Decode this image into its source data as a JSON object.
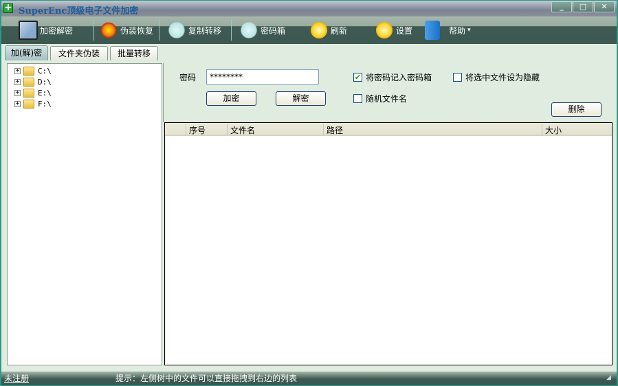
{
  "window": {
    "title": "SuperEnc顶级电子文件加密",
    "minimize": "_",
    "maximize": "□",
    "close": "✕"
  },
  "toolbar": {
    "items": [
      {
        "label": "加密解密",
        "icon": "kirby-folder-icon"
      },
      {
        "label": "伪装恢复",
        "icon": "flower-icon"
      },
      {
        "label": "复制转移",
        "icon": "bear-icon"
      },
      {
        "label": "密码箱",
        "icon": "bear-icon"
      },
      {
        "label": "刷新",
        "icon": "sun-icon"
      },
      {
        "label": "设置",
        "icon": "sun-icon"
      },
      {
        "label": "帮助",
        "icon": "box-icon",
        "dropdown": "▾"
      }
    ]
  },
  "tabs": [
    {
      "label": "加(解)密",
      "active": true
    },
    {
      "label": "文件夹伪装"
    },
    {
      "label": "批量转移"
    }
  ],
  "tree": {
    "drives": [
      "C:\\",
      "D:\\",
      "E:\\",
      "F:\\"
    ]
  },
  "settings": {
    "password_label": "密码",
    "password_value": "********",
    "encrypt": "加密",
    "decrypt": "解密",
    "delete": "删除",
    "save_to_box": {
      "label": "将密码记入密码箱",
      "checked": true
    },
    "hide_selected": {
      "label": "将选中文件设为隐藏",
      "checked": false
    },
    "random_name": {
      "label": "随机文件名",
      "checked": false
    }
  },
  "list": {
    "columns": [
      "序号",
      "文件名",
      "路径",
      "大小"
    ],
    "rows": []
  },
  "status": {
    "register": "未注册",
    "hint": "提示：左侧树中的文件可以直接拖拽到右边的列表"
  }
}
